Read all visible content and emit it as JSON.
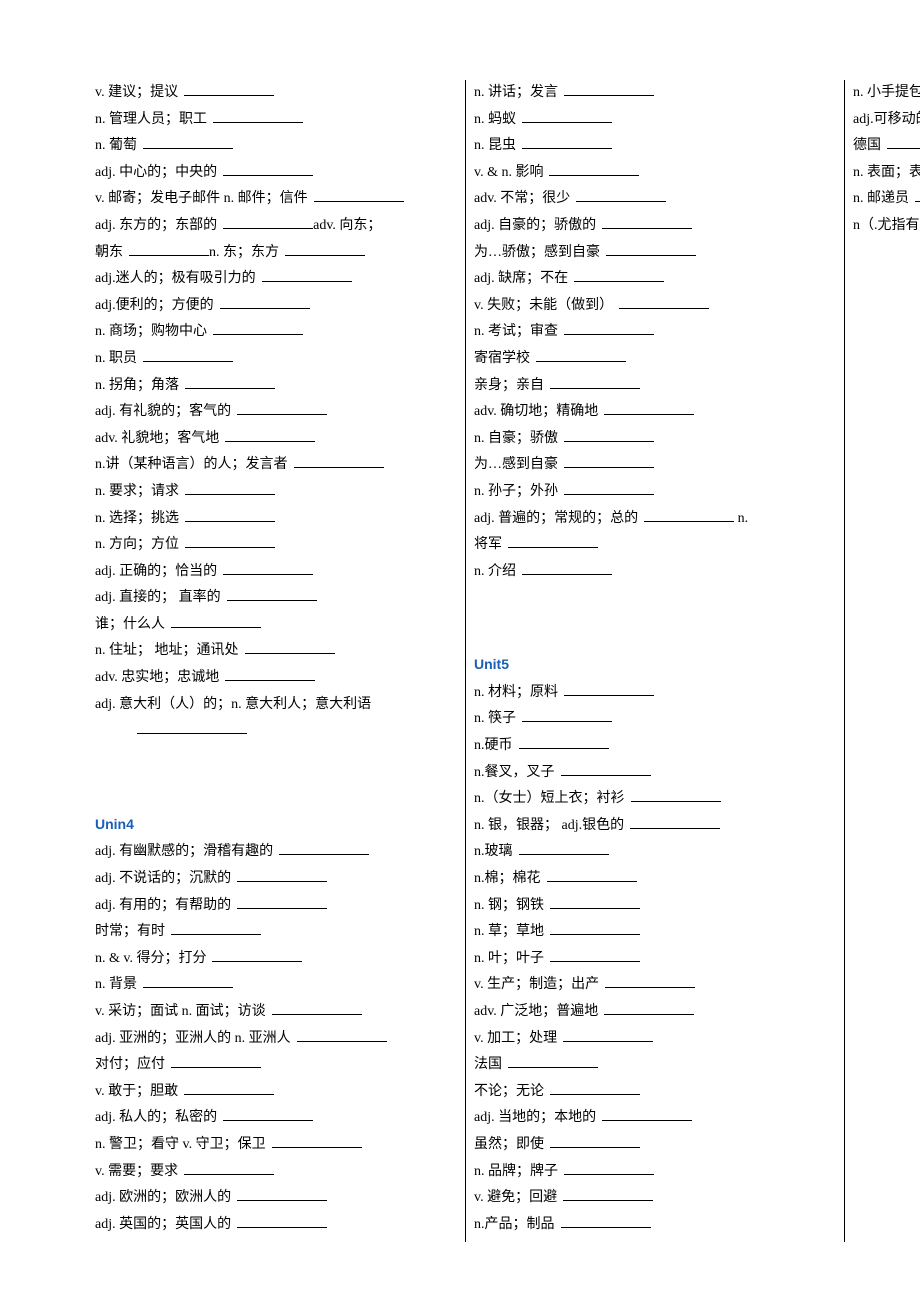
{
  "col1_top": [
    {
      "t": "v. 建议；提议"
    },
    {
      "t": "n. 管理人员；职工"
    },
    {
      "t": "n. 葡萄"
    },
    {
      "t": "adj. 中心的；中央的"
    },
    {
      "t": "v. 邮寄；发电子邮件 n. 邮件；信件"
    },
    {
      "t": "adj. 东方的；东部的",
      "after": "adv. 向东；",
      "noblank2": true
    },
    {
      "t": "朝东",
      "mid": "n. 东；东方",
      "twoblanks": true
    },
    {
      "t": "adj.迷人的；极有吸引力的"
    },
    {
      "t": "adj.便利的；方便的"
    },
    {
      "t": "n. 商场；购物中心"
    },
    {
      "t": "n. 职员"
    },
    {
      "t": "n. 拐角；角落"
    },
    {
      "t": "adj. 有礼貌的；客气的"
    },
    {
      "t": "adv. 礼貌地；客气地"
    },
    {
      "t": "n.讲（某种语言）的人；发言者"
    },
    {
      "t": "n. 要求；请求"
    },
    {
      "t": "n. 选择；挑选"
    },
    {
      "t": "n. 方向；方位"
    },
    {
      "t": "adj. 正确的；恰当的"
    },
    {
      "t": "adj. 直接的； 直率的"
    },
    {
      "t": "谁；什么人"
    },
    {
      "t": "n. 住址； 地址；通讯处"
    },
    {
      "t": "adv. 忠实地；忠诚地"
    },
    {
      "t": "adj. 意大利（人）的；n. 意大利人；意大利语",
      "noblank": true
    },
    {
      "t": "",
      "blankonly": true,
      "indent": true
    }
  ],
  "unit4_heading": "Unin4",
  "col1_unit4": [
    {
      "t": "adj.  有幽默感的；滑稽有趣的"
    },
    {
      "t": "adj. 不说话的；沉默的"
    },
    {
      "t": "adj. 有用的；有帮助的"
    },
    {
      "t": "时常；有时"
    },
    {
      "t": "n. & v. 得分；打分"
    },
    {
      "t": "n. 背景"
    },
    {
      "t": "v. 采访；面试 n. 面试；访谈"
    },
    {
      "t": "adj. 亚洲的；亚洲人的 n. 亚洲人"
    },
    {
      "t": "对付；应付"
    },
    {
      "t": "v. 敢于；胆敢"
    },
    {
      "t": "adj. 私人的；私密的"
    },
    {
      "t": "n. 警卫；看守 v. 守卫；保卫"
    },
    {
      "t": "v. 需要；要求"
    },
    {
      "t": "adj. 欧洲的；欧洲人的"
    },
    {
      "t": "adj. 英国的；英国人的"
    },
    {
      "t": "n. 讲话；发言"
    },
    {
      "t": "n. 蚂蚁"
    },
    {
      "t": "n. 昆虫"
    }
  ],
  "col2_top": [
    {
      "t": "v. & n. 影响"
    },
    {
      "t": "adv. 不常；很少"
    },
    {
      "t": "adj. 自豪的；骄傲的"
    },
    {
      "t": "为…骄傲；感到自豪"
    },
    {
      "t": "adj. 缺席；不在"
    },
    {
      "t": "v. 失败；未能（做到）"
    },
    {
      "t": "n. 考试；审查"
    },
    {
      "t": "寄宿学校"
    },
    {
      "t": "亲身；亲自"
    },
    {
      "t": "adv. 确切地；精确地"
    },
    {
      "t": "n. 自豪；骄傲"
    },
    {
      "t": "为…感到自豪"
    },
    {
      "t": "n. 孙子；外孙"
    },
    {
      "t": "adj. 普遍的；常规的；总的",
      "after": "    n.",
      "noblank2": true
    },
    {
      "t": "将军"
    },
    {
      "t": "n. 介绍"
    }
  ],
  "unit5_heading": "Unit5",
  "col2_unit5": [
    {
      "t": "n. 材料；原料"
    },
    {
      "t": "n.  筷子"
    },
    {
      "t": "n.硬币"
    },
    {
      "t": "n.餐叉，叉子"
    },
    {
      "t": "n.（女士）短上衣；衬衫"
    },
    {
      "t": "n. 银，银器；   adj.银色的"
    },
    {
      "t": "n.玻璃"
    },
    {
      "t": "n.棉；棉花"
    },
    {
      "t": "n. 钢；钢铁"
    },
    {
      "t": "n. 草；草地"
    },
    {
      "t": "n. 叶；叶子"
    },
    {
      "t": "v. 生产；制造；出产"
    },
    {
      "t": "adv. 广泛地；普遍地"
    },
    {
      "t": "v. 加工；处理"
    },
    {
      "t": "法国"
    },
    {
      "t": "不论；无论"
    },
    {
      "t": "adj. 当地的；本地的"
    },
    {
      "t": "虽然；即使"
    },
    {
      "t": "n. 品牌；牌子"
    },
    {
      "t": "v. 避免；回避"
    },
    {
      "t": "n.产品；制品"
    },
    {
      "t": "n. 小手提包"
    },
    {
      "t": "adj.可移动的；非固定的"
    },
    {
      "t": "德国"
    },
    {
      "t": "n. 表面；表层"
    },
    {
      "t": "n. 邮递员"
    },
    {
      "t": "n（.尤指有帽舌的）帽子"
    }
  ]
}
